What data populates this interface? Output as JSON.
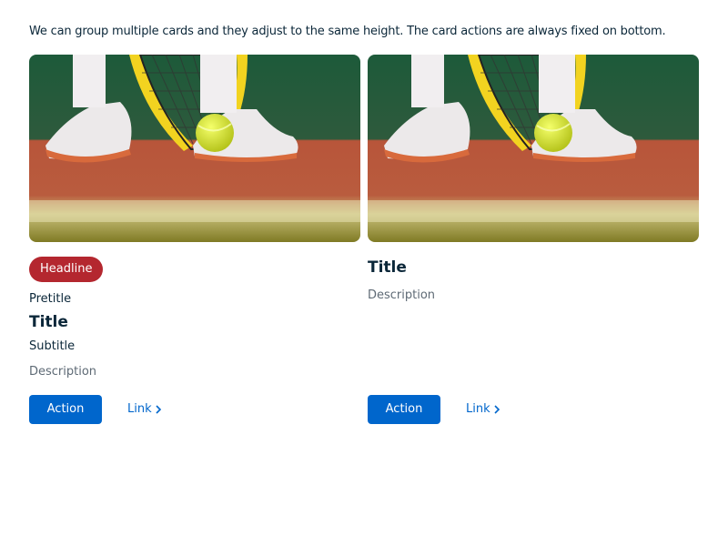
{
  "intro_text": "We can group multiple cards and they adjust to the same height. The card actions are always fixed on bottom.",
  "colors": {
    "brand_blue": "#0066cc",
    "headline_red": "#b4272f",
    "text_primary": "#0b2739",
    "text_secondary": "#5e6a75"
  },
  "cards": [
    {
      "media_icon": "tennis-court-photo",
      "headline": "Headline",
      "pretitle": "Pretitle",
      "title": "Title",
      "subtitle": "Subtitle",
      "description": "Description",
      "action_label": "Action",
      "link_label": "Link",
      "link_icon": "chevron-right-icon"
    },
    {
      "media_icon": "tennis-court-photo",
      "title": "Title",
      "description": "Description",
      "action_label": "Action",
      "link_label": "Link",
      "link_icon": "chevron-right-icon"
    }
  ]
}
